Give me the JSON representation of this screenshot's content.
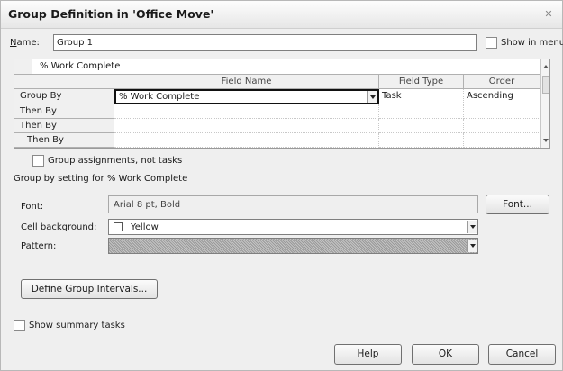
{
  "window": {
    "title": "Group Definition in 'Office Move'",
    "close_glyph": "✕"
  },
  "name_row": {
    "label": "Name:",
    "label_accesskey": "N",
    "label_rest": "ame:",
    "value": "Group 1",
    "show_in_menu_label": "Show in menu",
    "show_in_menu_checked": false
  },
  "grid": {
    "edit_bar_value": "% Work Complete",
    "columns": [
      "Field Name",
      "Field Type",
      "Order"
    ],
    "rows": [
      {
        "label": "Group By",
        "field_name": "% Work Complete",
        "field_type": "Task",
        "order": "Ascending"
      },
      {
        "label": "Then By",
        "field_name": "",
        "field_type": "",
        "order": ""
      },
      {
        "label": "Then By",
        "field_name": "",
        "field_type": "",
        "order": ""
      },
      {
        "label": "Then By",
        "field_name": "",
        "field_type": "",
        "order": ""
      }
    ]
  },
  "group_assignments": {
    "label": "Group assignments, not tasks",
    "checked": false
  },
  "setting": {
    "heading": "Group by setting for % Work Complete",
    "font_label": "Font:",
    "font_value": "Arial 8 pt, Bold",
    "font_button": "Font...",
    "cell_bg_label": "Cell background:",
    "cell_bg_value": "Yellow",
    "cell_bg_color": "#ffffff",
    "pattern_label": "Pattern:"
  },
  "define_intervals_button": "Define Group Intervals...",
  "show_summary": {
    "label": "Show summary tasks",
    "checked": false
  },
  "buttons": {
    "help": "Help",
    "ok": "OK",
    "cancel": "Cancel"
  }
}
